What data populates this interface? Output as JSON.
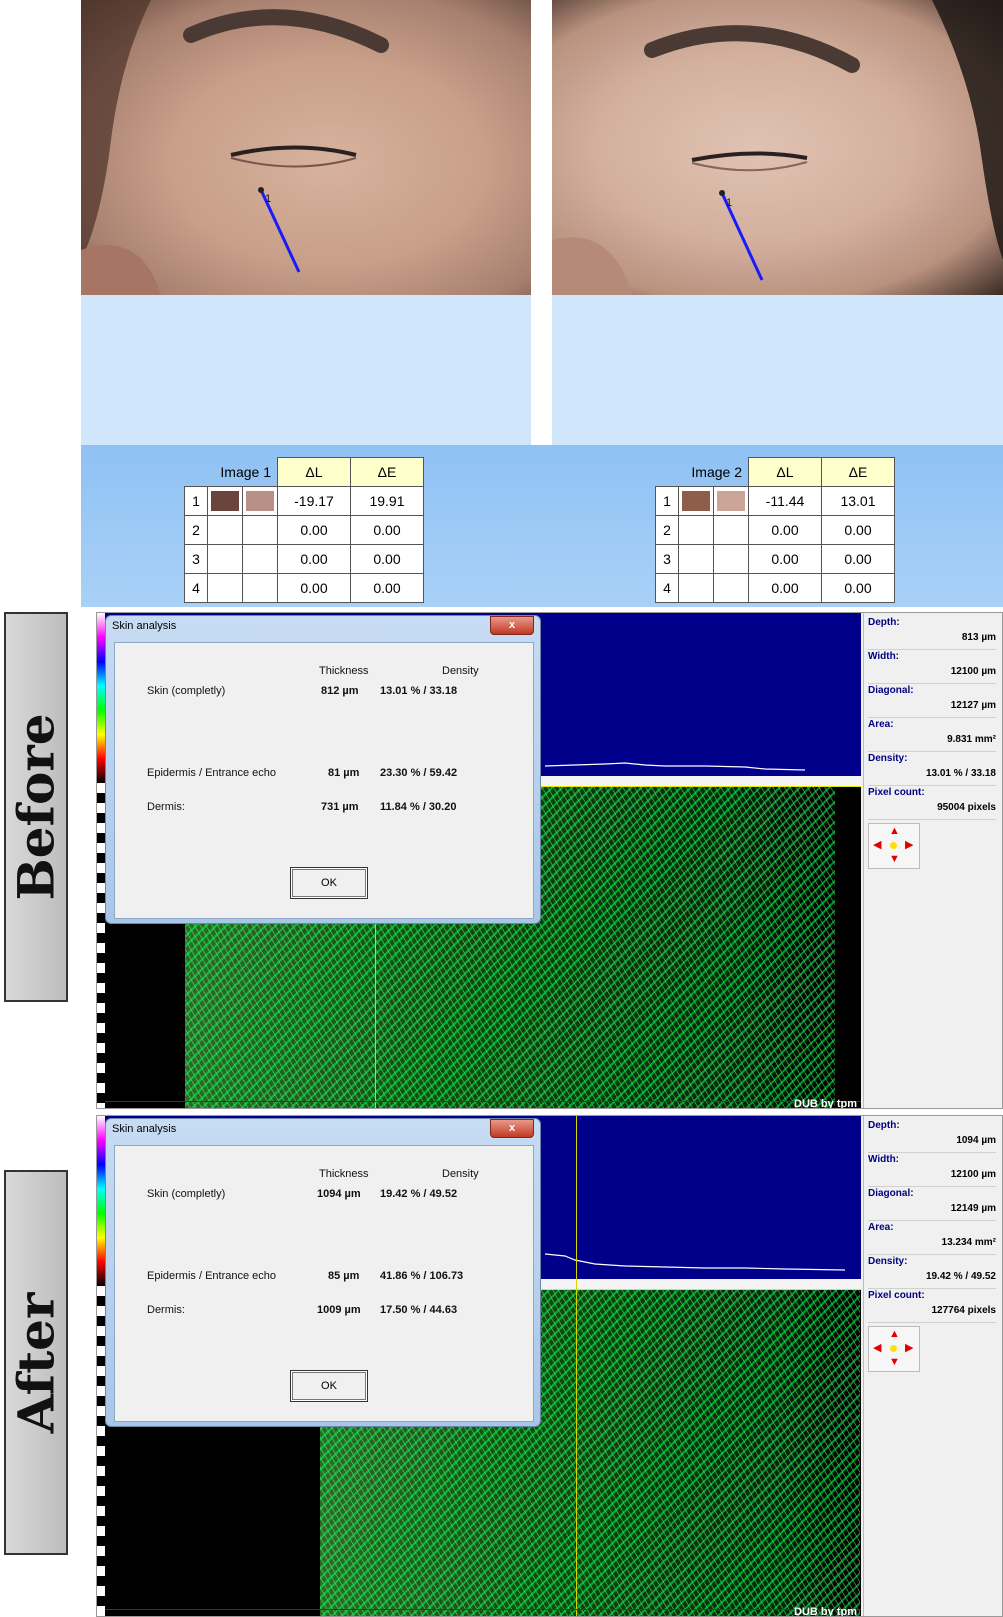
{
  "images": [
    {
      "marker_label": "1",
      "table": {
        "label": "Image 1",
        "headers": [
          "ΔL",
          "ΔE"
        ],
        "rows": [
          {
            "index": "1",
            "swatch1": "#6a453d",
            "swatch2": "#b89088",
            "dl": "-19.17",
            "de": "19.91"
          },
          {
            "index": "2",
            "dl": "0.00",
            "de": "0.00"
          },
          {
            "index": "3",
            "dl": "0.00",
            "de": "0.00"
          },
          {
            "index": "4",
            "dl": "0.00",
            "de": "0.00"
          }
        ]
      }
    },
    {
      "marker_label": "1",
      "table": {
        "label": "Image 2",
        "headers": [
          "ΔL",
          "ΔE"
        ],
        "rows": [
          {
            "index": "1",
            "swatch1": "#8f5e4a",
            "swatch2": "#caa598",
            "dl": "-11.44",
            "de": "13.01"
          },
          {
            "index": "2",
            "dl": "0.00",
            "de": "0.00"
          },
          {
            "index": "3",
            "dl": "0.00",
            "de": "0.00"
          },
          {
            "index": "4",
            "dl": "0.00",
            "de": "0.00"
          }
        ]
      }
    }
  ],
  "side_labels": {
    "before": "Before",
    "after": "After"
  },
  "panels": [
    {
      "dialog": {
        "title": "Skin analysis",
        "close": "x",
        "col_thickness": "Thickness",
        "col_density": "Density",
        "rows": [
          {
            "name": "Skin (completly)",
            "thickness": "812 µm",
            "density": "13.01 %  /  33.18"
          },
          {
            "name": "Epidermis / Entrance echo",
            "thickness": "81 µm",
            "density": "23.30 %  /  59.42"
          },
          {
            "name": "Dermis:",
            "thickness": "731 µm",
            "density": "11.84 %  /  30.20"
          }
        ],
        "ok": "OK"
      },
      "stats": {
        "depth_label": "Depth:",
        "depth": "813 µm",
        "width_label": "Width:",
        "width": "12100 µm",
        "diagonal_label": "Diagonal:",
        "diagonal": "12127 µm",
        "area_label": "Area:",
        "area": "9.831 mm²",
        "density_label": "Density:",
        "density": "13.01 %  /  33.18",
        "pixel_label": "Pixel count:",
        "pixel": "95004 pixels"
      },
      "watermark": "DUB by tpm"
    },
    {
      "dialog": {
        "title": "Skin analysis",
        "close": "x",
        "col_thickness": "Thickness",
        "col_density": "Density",
        "rows": [
          {
            "name": "Skin (completly)",
            "thickness": "1094 µm",
            "density": "19.42 %  /  49.52"
          },
          {
            "name": "Epidermis / Entrance echo",
            "thickness": "85 µm",
            "density": "41.86 %  /  106.73"
          },
          {
            "name": "Dermis:",
            "thickness": "1009 µm",
            "density": "17.50 %  /  44.63"
          }
        ],
        "ok": "OK"
      },
      "stats": {
        "depth_label": "Depth:",
        "depth": "1094 µm",
        "width_label": "Width:",
        "width": "12100 µm",
        "diagonal_label": "Diagonal:",
        "diagonal": "12149 µm",
        "area_label": "Area:",
        "area": "13.234 mm²",
        "density_label": "Density:",
        "density": "19.42 %  /  49.52",
        "pixel_label": "Pixel count:",
        "pixel": "127764 pixels"
      },
      "watermark": "DUB by tpm"
    }
  ],
  "colors": {
    "table_header_bg": "#ffffcc",
    "us_top_bg": "#00008b",
    "echo_green": "#00ff50",
    "measure_line": "#1a1aff"
  }
}
